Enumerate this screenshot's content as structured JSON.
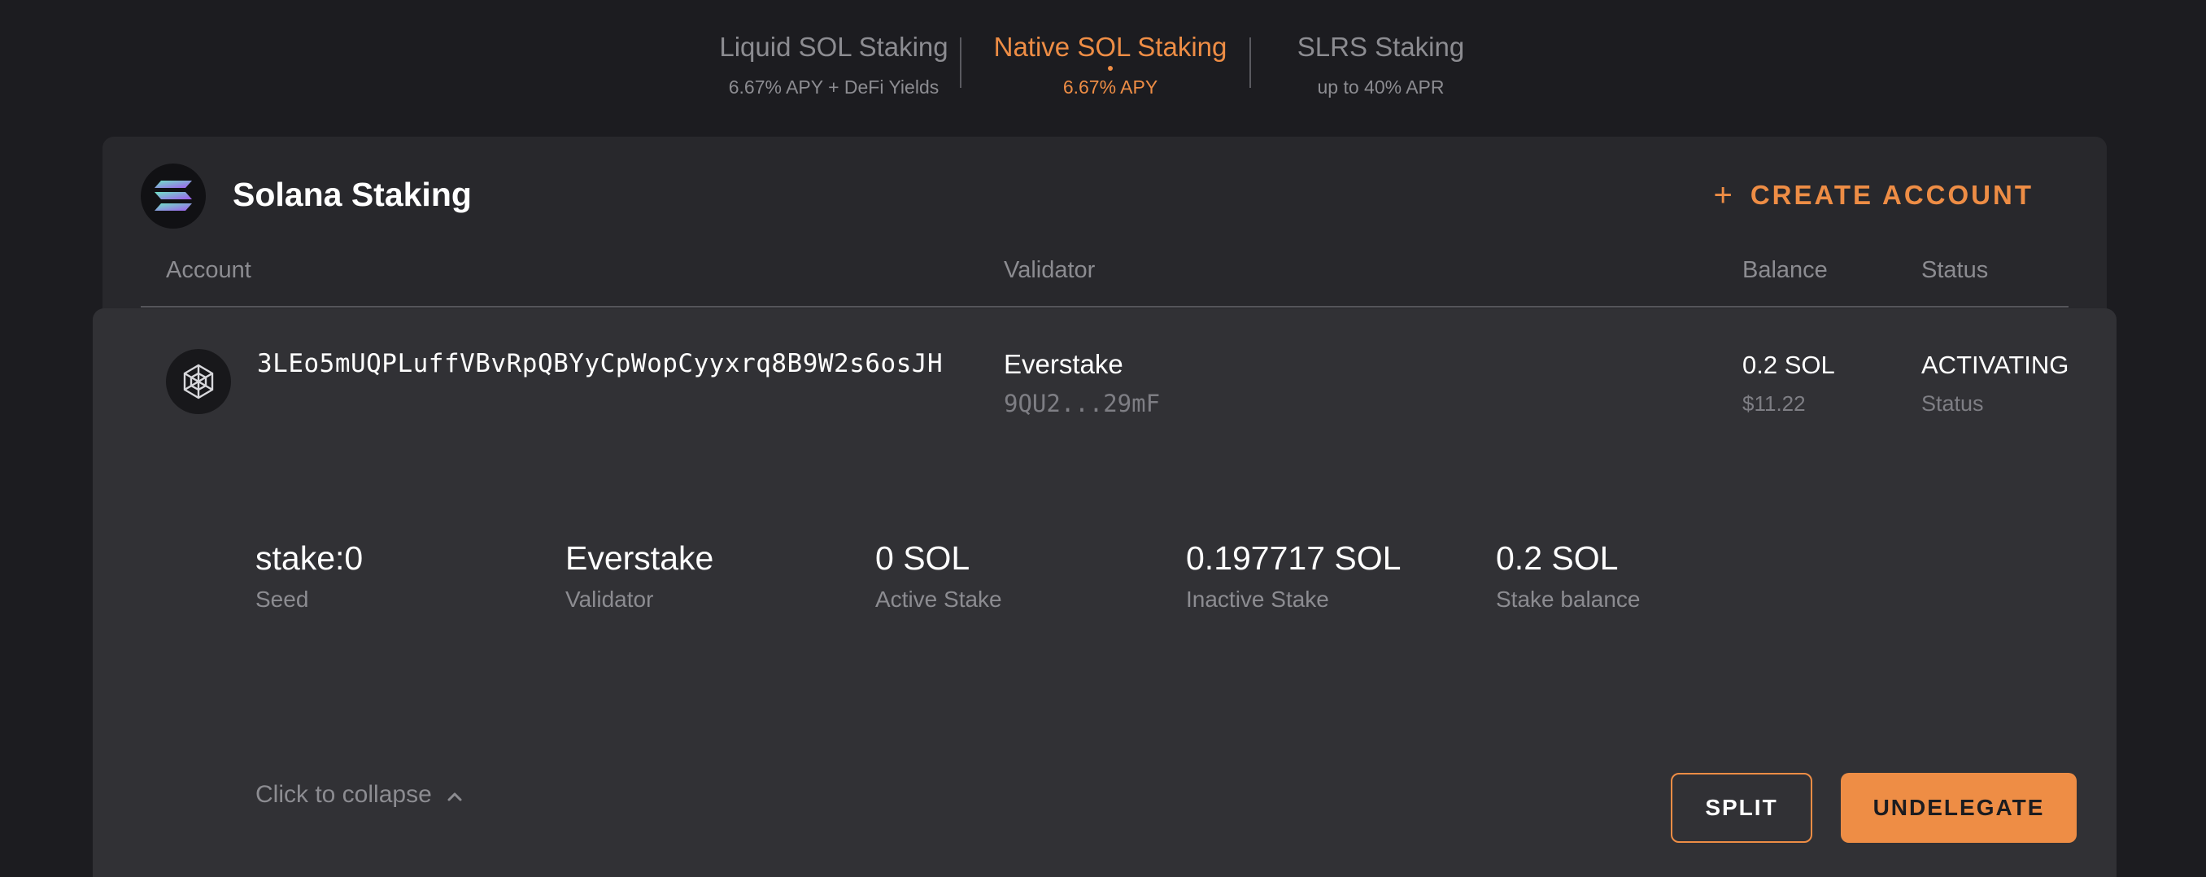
{
  "tabs": [
    {
      "title": "Liquid SOL Staking",
      "subtitle": "6.67% APY + DeFi Yields",
      "active": false
    },
    {
      "title": "Native SOL Staking",
      "subtitle": "6.67% APY",
      "active": true
    },
    {
      "title": "SLRS Staking",
      "subtitle": "up to 40% APR",
      "active": false
    }
  ],
  "card": {
    "title": "Solana Staking",
    "logo_icon": "solana-logo-icon",
    "create_button": {
      "icon": "plus-icon",
      "label": "CREATE ACCOUNT"
    },
    "columns": {
      "account": "Account",
      "validator": "Validator",
      "balance": "Balance",
      "status": "Status"
    }
  },
  "row": {
    "icon": "validator-hexagon-icon",
    "address": "3LEo5mUQPLuffVBvRpQBYyCpWopCyyxrq8B9W2s6osJH",
    "validator_name": "Everstake",
    "validator_address": "9QU2...29mF",
    "balance_sol": "0.2 SOL",
    "balance_usd": "$11.22",
    "status": "ACTIVATING",
    "status_label": "Status"
  },
  "details": [
    {
      "value": "stake:0",
      "label": "Seed"
    },
    {
      "value": "Everstake",
      "label": "Validator"
    },
    {
      "value": "0 SOL",
      "label": "Active Stake"
    },
    {
      "value": "0.197717 SOL",
      "label": "Inactive Stake"
    },
    {
      "value": "0.2 SOL",
      "label": "Stake balance"
    }
  ],
  "actions": {
    "collapse_label": "Click to collapse",
    "collapse_icon": "chevron-up-icon",
    "split_label": "SPLIT",
    "undelegate_label": "UNDELEGATE"
  },
  "colors": {
    "background": "#1c1c20",
    "card": "#28282c",
    "panel": "#313135",
    "accent": "#ee8d45",
    "muted_text": "#8c8c91"
  }
}
